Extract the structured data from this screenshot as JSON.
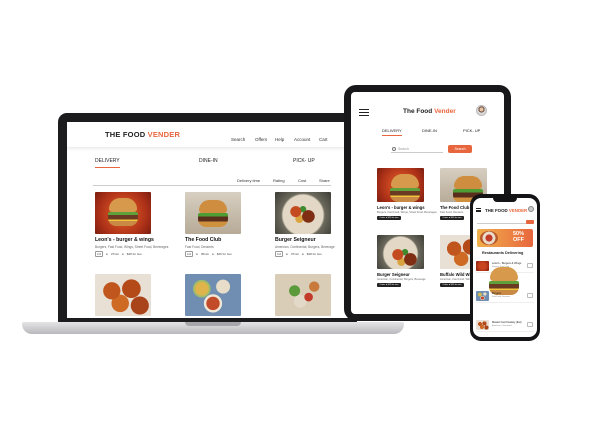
{
  "brand": {
    "prefix": "THE FOOD",
    "suffix": "VENDER",
    "tablet_prefix": "The Food",
    "tablet_suffix": "Vender",
    "accent_color": "#e8663d"
  },
  "laptop": {
    "nav": [
      "Search",
      "Offers",
      "Help",
      "Account",
      "Cart"
    ],
    "tabs": [
      "DELIVERY",
      "DINE-IN",
      "PICK- UP"
    ],
    "filters": [
      "Delivery time",
      "Rating",
      "Cost",
      "Share"
    ],
    "cards": [
      {
        "title": "Leon's - burger & wings",
        "sub": "Burgers, Fast Food, Wings, Street Food, Beverages",
        "rating": "4.0",
        "time": "37min",
        "cost": "$28 for two",
        "image": "burger-photo"
      },
      {
        "title": "The Food Club",
        "sub": "Fast Food, Desserts",
        "rating": "4.0",
        "time": "35min",
        "cost": "$26 for two",
        "image": "burger-photo"
      },
      {
        "title": "Burger Seigneur",
        "sub": "American, Continental, Burgers, Beverage",
        "rating": "4.0",
        "time": "37min",
        "cost": "$28 for two",
        "image": "dish-photo"
      }
    ]
  },
  "tablet": {
    "tabs": [
      "DELIVERY",
      "DINE-IN",
      "PICK- UP"
    ],
    "search_placeholder": "Search",
    "search_button": "Search",
    "cards": [
      {
        "title": "Leon's - burger & wings",
        "sub": "Burgers, Fast Food, Wings, Street Food, Beverages",
        "button": "Order ● $28 for two"
      },
      {
        "title": "The Food Club",
        "sub": "Fast Food, Desserts",
        "button": "Order ● $26 for two"
      },
      {
        "title": "Burger Seigneur",
        "sub": "American, Continental, Burgers, Beverage",
        "button": "Order ● $28 for two"
      },
      {
        "title": "Buffalo Wild Wings",
        "sub": "American, Fast Food, Wings, Beverages",
        "button": "Order ● $26 for two"
      }
    ]
  },
  "phone": {
    "brand_prefix": "THE FOOD",
    "brand_suffix": "VENDER",
    "offer_line1": "50%",
    "offer_line2": "OFF",
    "heading": "Restaurants Delivering",
    "rows": [
      {
        "title": "Leon's - Burgers & Wings",
        "sub": "Burgers, Fast Food"
      },
      {
        "title": "Burgers",
        "sub": "Fast Food, Desserts"
      },
      {
        "title": "Master Food Galaxy (Est)",
        "sub": "American, Continental"
      }
    ]
  }
}
